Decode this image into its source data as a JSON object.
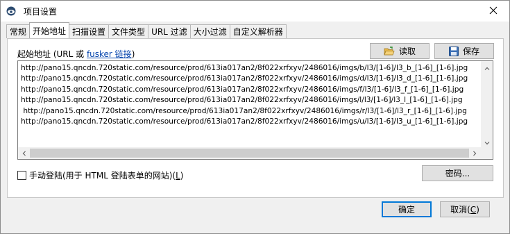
{
  "window": {
    "title": "项目设置",
    "icons": {
      "app": "app-icon",
      "close": "close-icon"
    }
  },
  "tabs": [
    {
      "label": "常规"
    },
    {
      "label": "开始地址",
      "active": true
    },
    {
      "label": "扫描设置"
    },
    {
      "label": "文件类型"
    },
    {
      "label": "URL 过滤"
    },
    {
      "label": "大小过滤"
    },
    {
      "label": "自定义解析器"
    }
  ],
  "source": {
    "label_prefix": "起始地址 (URL 或 ",
    "link_text": "fusker 链接",
    "label_suffix": ")",
    "read_button": "读取",
    "read_icon": "open-folder-icon",
    "save_button": "保存",
    "save_icon": "floppy-disk-icon",
    "urls": [
      "http://pano15.qncdn.720static.com/resource/prod/613ia017an2/8f022xrfxyv/2486016/imgs/b/l3/[1-6]/l3_b_[1-6]_[1-6].jpg",
      "http://pano15.qncdn.720static.com/resource/prod/613ia017an2/8f022xrfxyv/2486016/imgs/d/l3/[1-6]/l3_d_[1-6]_[1-6].jpg",
      "http://pano15.qncdn.720static.com/resource/prod/613ia017an2/8f022xrfxyv/2486016/imgs/f/l3/[1-6]/l3_f_[1-6]_[1-6].jpg",
      "http://pano15.qncdn.720static.com/resource/prod/613ia017an2/8f022xrfxyv/2486016/imgs/l/l3/[1-6]/l3_l_[1-6]_[1-6].jpg",
      " http://pano15.qncdn.720static.com/resource/prod/613ia017an2/8f022xrfxyv/2486016/imgs/r/l3/[1-6]/l3_r_[1-6]_[1-6].jpg",
      "http://pano15.qncdn.720static.com/resource/prod/613ia017an2/8f022xrfxyv/2486016/imgs/u/l3/[1-6]/l3_u_[1-6]_[1-6].jpg"
    ]
  },
  "login": {
    "label": "手动登陆(用于 HTML 登陆表单的网站)(",
    "accel": "L",
    "label_end": ")",
    "checked": false,
    "password_button": "密码..."
  },
  "footer": {
    "ok_button": "确定",
    "cancel_prefix": "取消(",
    "cancel_accel": "C",
    "cancel_suffix": ")"
  }
}
